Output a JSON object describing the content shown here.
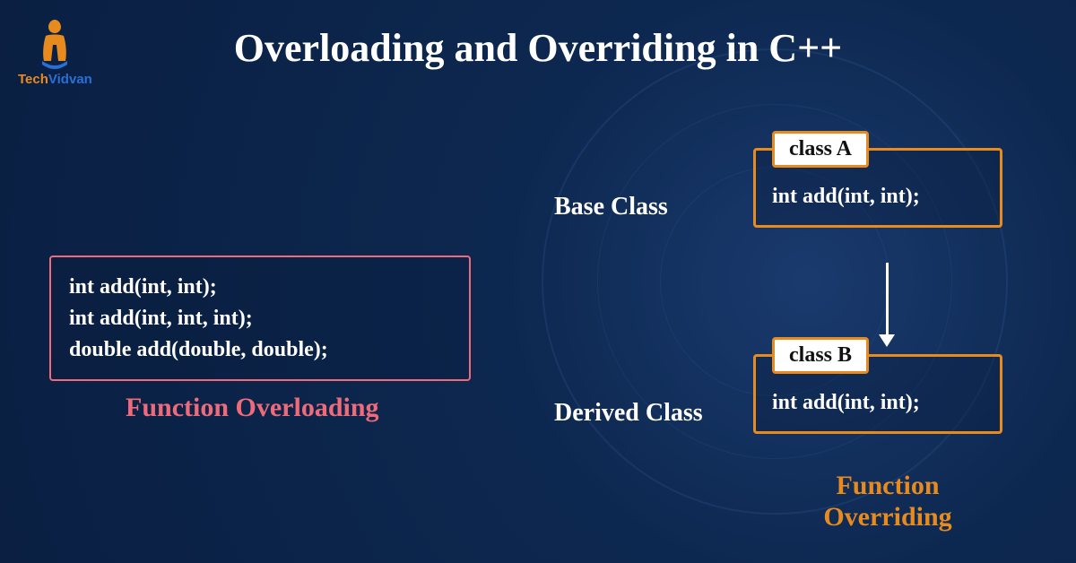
{
  "logo": {
    "brand_part1": "Tech",
    "brand_part2": "Vidvan"
  },
  "title": "Overloading and Overriding in C++",
  "overloading": {
    "lines": [
      "int add(int, int);",
      "int add(int, int, int);",
      "double add(double, double);"
    ],
    "label": "Function Overloading"
  },
  "overriding": {
    "base_label": "Base Class",
    "derived_label": "Derived Class",
    "class_a": {
      "name": "class A",
      "code": "int add(int, int);"
    },
    "class_b": {
      "name": "class B",
      "code": "int add(int, int);"
    },
    "label": "Function\nOverriding"
  },
  "colors": {
    "accent_orange": "#e88b1e",
    "accent_pink": "#ef6b7a",
    "bg_dark": "#0a1f42"
  }
}
